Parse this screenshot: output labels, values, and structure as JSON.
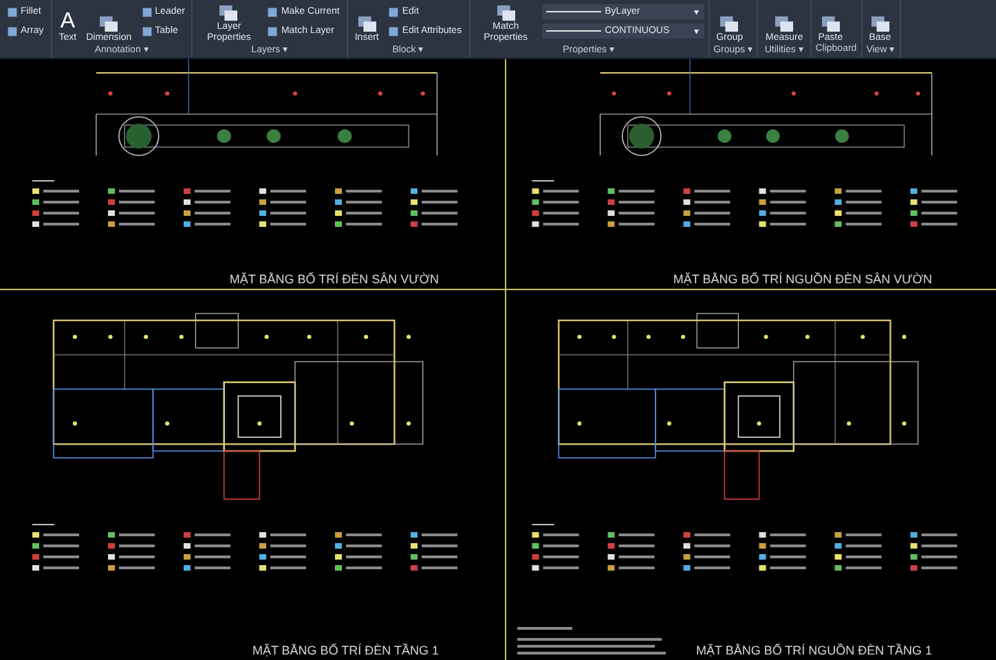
{
  "ribbon": {
    "panels": [
      {
        "tools": [
          {
            "kind": "small",
            "label": "Fillet"
          },
          {
            "kind": "small",
            "label": "Array"
          }
        ]
      },
      {
        "label": "Annotation ▾",
        "tools": [
          {
            "kind": "glyph",
            "glyph": "A",
            "label": "Text"
          },
          {
            "kind": "large",
            "label": "Dimension"
          },
          {
            "kind": "small",
            "label": "Leader"
          },
          {
            "kind": "small",
            "label": "Table"
          }
        ]
      },
      {
        "label": "Layers ▾",
        "tools": [
          {
            "kind": "large",
            "label": "Layer Properties"
          },
          {
            "kind": "small",
            "label": "Make Current"
          },
          {
            "kind": "small",
            "label": "Match Layer"
          }
        ]
      },
      {
        "label": "Block ▾",
        "tools": [
          {
            "kind": "large",
            "label": "Insert"
          },
          {
            "kind": "small",
            "label": "Edit"
          },
          {
            "kind": "small",
            "label": "Edit Attributes"
          }
        ]
      },
      {
        "label": "Properties ▾",
        "tools": [
          {
            "kind": "large",
            "label": "Match Properties"
          },
          {
            "kind": "dropdown",
            "label": "ByLayer",
            "caret": "▾"
          },
          {
            "kind": "dropdown",
            "label": "CONTINUOUS",
            "caret": "▾"
          }
        ]
      },
      {
        "label": "Groups ▾",
        "tools": [
          {
            "kind": "large",
            "label": "Group"
          }
        ]
      },
      {
        "label": "Utilities ▾",
        "tools": [
          {
            "kind": "large",
            "label": "Measure"
          }
        ]
      },
      {
        "label": "Clipboard",
        "tools": [
          {
            "kind": "large",
            "label": "Paste"
          }
        ]
      },
      {
        "label": "View ▾",
        "tools": [
          {
            "kind": "large",
            "label": "Base"
          }
        ]
      }
    ]
  },
  "sheets": [
    {
      "kind": "garden",
      "title": "MẶT BẰNG BỐ TRÍ ĐÈN SÂN VƯỜN"
    },
    {
      "kind": "garden",
      "title": "MẶT BẰNG BỐ TRÍ NGUỒN ĐÈN SÂN VƯỜN"
    },
    {
      "kind": "floor",
      "title": "MẶT BẰNG BỐ TRÍ ĐÈN TẦNG 1"
    },
    {
      "kind": "floor",
      "title": "MẶT BẰNG BỐ TRÍ NGUỒN ĐÈN TẦNG 1",
      "notes": true
    }
  ]
}
